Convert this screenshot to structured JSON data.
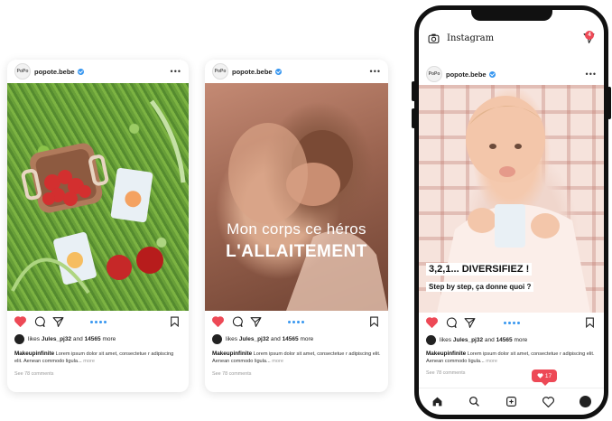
{
  "posts": [
    {
      "username": "popote.bebe",
      "logo_text": "PoPo",
      "more": "•••",
      "liked_by_prefix": "likes",
      "liked_by_user": "Jules_pj32",
      "liked_by_and": "and",
      "like_count": "14565",
      "liked_by_suffix": "more",
      "caption_user": "Makeupinfinite",
      "caption_text": "Lorem ipsum dolor sit amet, consectetue r adipiscing elit. Aenean commodo ligula...",
      "caption_more": "more",
      "comments": "See 78 comments",
      "liked": false
    },
    {
      "username": "popote.bebe",
      "logo_text": "PoPo",
      "more": "•••",
      "overlay_line1": "Mon corps ce héros",
      "overlay_line2": "L'ALLAITEMENT",
      "liked_by_prefix": "likes",
      "liked_by_user": "Jules_pj32",
      "liked_by_and": "and",
      "like_count": "14565",
      "liked_by_suffix": "more",
      "caption_user": "Makeupinfinite",
      "caption_text": "Lorem ipsum dolor sit amet, consectetue r adipiscing elit. Aenean commodo ligula...",
      "caption_more": "more",
      "comments": "See 78 comments",
      "liked": true
    },
    {
      "username": "popote.bebe",
      "logo_text": "PoPo",
      "more": "•••",
      "overlay_line1": "3,2,1... DIVERSIFIEZ !",
      "overlay_line2": "Step by step, ça donne quoi ?",
      "liked_by_prefix": "likes",
      "liked_by_user": "Jules_pj32",
      "liked_by_and": "and",
      "like_count": "14565",
      "liked_by_suffix": "more",
      "caption_user": "Makeupinfinite",
      "caption_text": "Lorem ipsum dolor sit amet, consectetue r adipiscing elit. Aenean commodo ligula...",
      "caption_more": "more",
      "comments": "See 78 comments",
      "liked": true
    }
  ],
  "phone": {
    "app_title": "Instagram",
    "dm_badge": "4",
    "notification_count": "17"
  },
  "colors": {
    "like_red": "#ed4956",
    "dots_blue": "#3897f0"
  }
}
